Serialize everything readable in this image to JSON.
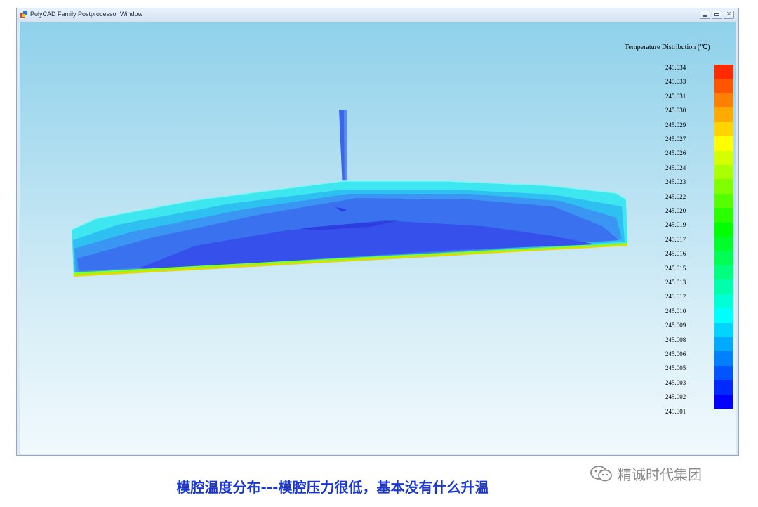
{
  "window": {
    "title": "PolyCAD Family Postprocessor Window",
    "controls": [
      "minimize",
      "maximize",
      "close"
    ]
  },
  "legend": {
    "title": "Temperature  Distribution (℃)",
    "labels": [
      "245.034",
      "245.033",
      "245.031",
      "245.030",
      "245.029",
      "245.027",
      "245.026",
      "245.024",
      "245.023",
      "245.022",
      "245.020",
      "245.019",
      "245.017",
      "245.016",
      "245.015",
      "245.013",
      "245.012",
      "245.010",
      "245.009",
      "245.008",
      "245.006",
      "245.005",
      "245.003",
      "245.002",
      "245.001"
    ],
    "colors": [
      "#ff2a00",
      "#ff5500",
      "#ff7f00",
      "#ffaa00",
      "#ffd400",
      "#ffff00",
      "#d4ff00",
      "#aaff00",
      "#7fff00",
      "#55ff00",
      "#2aff00",
      "#00ff00",
      "#00ff2a",
      "#00ff55",
      "#00ff7f",
      "#00ffaa",
      "#00ffd4",
      "#00ffff",
      "#00d4ff",
      "#00aaff",
      "#007fff",
      "#0055ff",
      "#002aff",
      "#0000ff"
    ]
  },
  "caption": "模腔温度分布---模腔压力很低，基本没有什么升温",
  "watermark": {
    "icon": "wechat-icon",
    "text": "精诚时代集团"
  }
}
